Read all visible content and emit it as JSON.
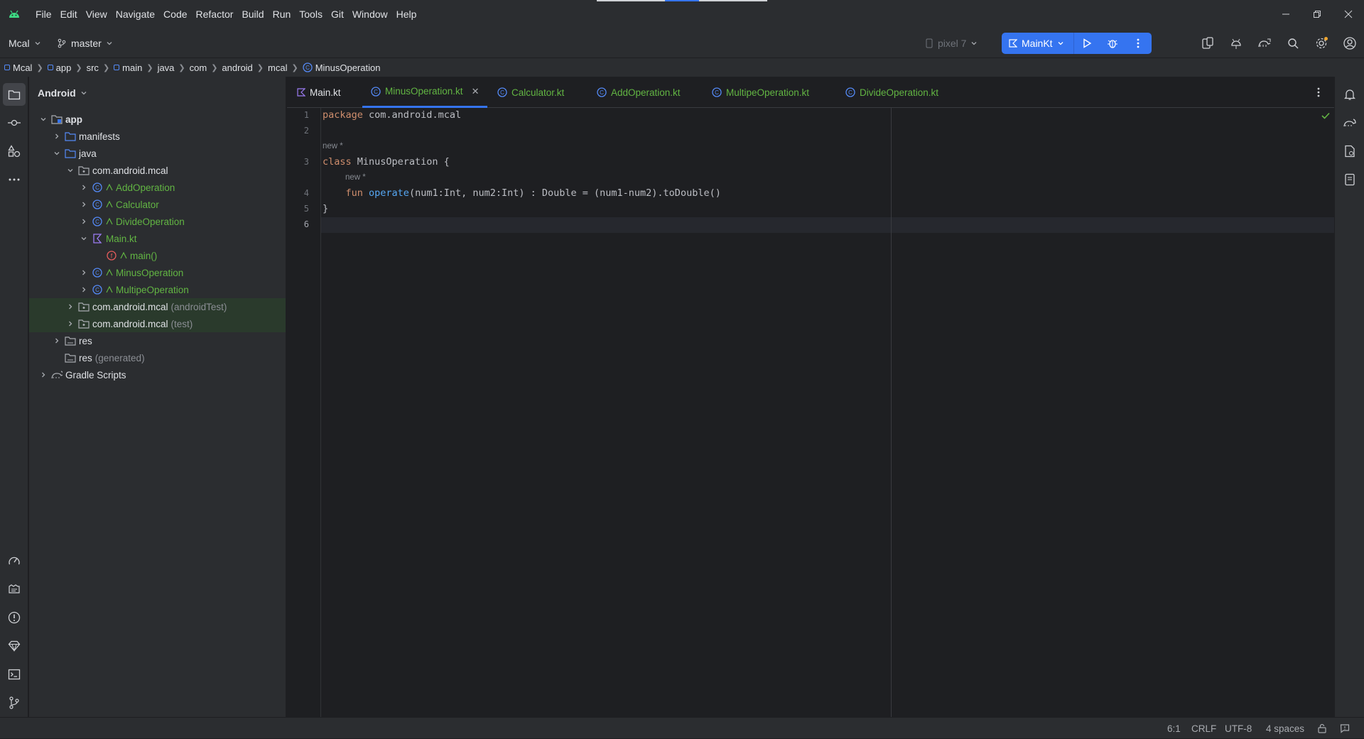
{
  "menu": [
    "File",
    "Edit",
    "View",
    "Navigate",
    "Code",
    "Refactor",
    "Build",
    "Run",
    "Tools",
    "Git",
    "Window",
    "Help"
  ],
  "toolbar": {
    "project": "Mcal",
    "branch": "master",
    "device": "pixel 7",
    "run_config": "MainKt"
  },
  "breadcrumb": [
    "Mcal",
    "app",
    "src",
    "main",
    "java",
    "com",
    "android",
    "mcal",
    "MinusOperation"
  ],
  "project_panel": {
    "view_mode": "Android",
    "tree": [
      {
        "label": "app",
        "suffix": ""
      },
      {
        "label": "manifests",
        "suffix": ""
      },
      {
        "label": "java",
        "suffix": ""
      },
      {
        "label": "com.android.mcal",
        "suffix": ""
      },
      {
        "label": "AddOperation",
        "suffix": ""
      },
      {
        "label": "Calculator",
        "suffix": ""
      },
      {
        "label": "DivideOperation",
        "suffix": ""
      },
      {
        "label": "Main.kt",
        "suffix": ""
      },
      {
        "label": "main()",
        "suffix": ""
      },
      {
        "label": "MinusOperation",
        "suffix": ""
      },
      {
        "label": "MultipeOperation",
        "suffix": ""
      },
      {
        "label": "com.android.mcal",
        "suffix": "(androidTest)"
      },
      {
        "label": "com.android.mcal",
        "suffix": "(test)"
      },
      {
        "label": "res",
        "suffix": ""
      },
      {
        "label": "res",
        "suffix": "(generated)"
      },
      {
        "label": "Gradle Scripts",
        "suffix": ""
      }
    ]
  },
  "tabs": [
    "Main.kt",
    "MinusOperation.kt",
    "Calculator.kt",
    "AddOperation.kt",
    "MultipeOperation.kt",
    "DivideOperation.kt"
  ],
  "editor": {
    "line_numbers": [
      "1",
      "2",
      "3",
      "4",
      "5",
      "6"
    ],
    "hint_new_1": "new *",
    "hint_new_2": "new *",
    "line1_kw": "package",
    "line1_rest": " com.android.mcal",
    "line3_kw": "class",
    "line3_rest": " MinusOperation {",
    "line4_indent": "    ",
    "line4_kw": "fun",
    "line4_fn": " operate",
    "line4_rest": "(num1:Int, num2:Int) : Double = (num1-num2).toDouble()",
    "line5": "}"
  },
  "status": {
    "position": "6:1",
    "line_sep": "CRLF",
    "encoding": "UTF-8",
    "indent": "4 spaces"
  },
  "colors": {
    "accent": "#3574f0",
    "keyword": "#cf8e6d",
    "function": "#56a8f5",
    "vcs_new": "#62b543"
  }
}
